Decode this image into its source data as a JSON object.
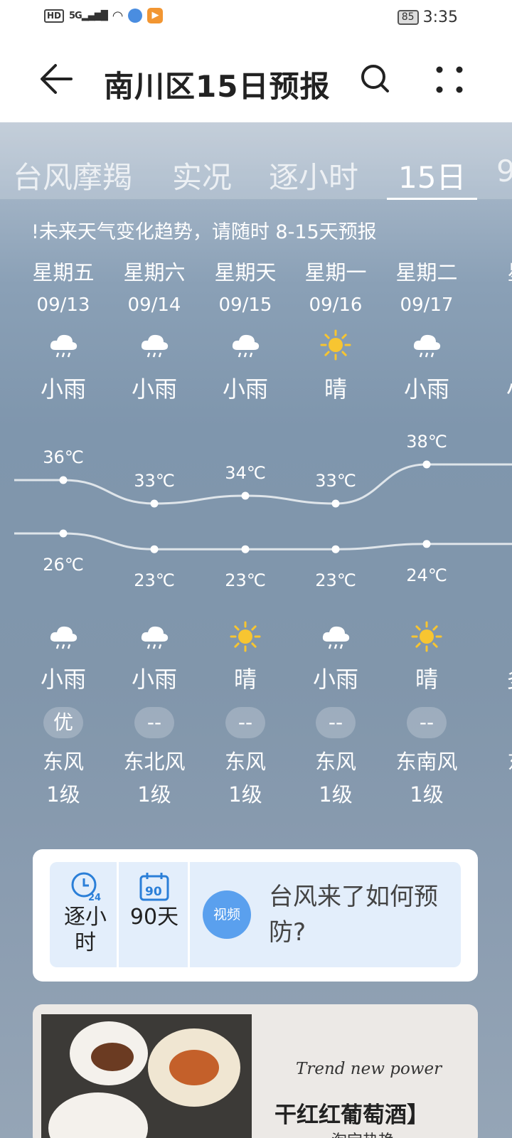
{
  "status": {
    "network": "5G",
    "hd": "HD",
    "battery": "85",
    "time": "3:35"
  },
  "header": {
    "title": "南川区15日预报"
  },
  "tabs": [
    {
      "label": "台风摩羯",
      "active": false
    },
    {
      "label": "实况",
      "active": false
    },
    {
      "label": "逐小时",
      "active": false
    },
    {
      "label": "15日",
      "active": true
    },
    {
      "label": "9",
      "active": false
    }
  ],
  "notice": "!未来天气变化趋势，请随时 8-15天预报",
  "forecast": [
    {
      "day": "星期五",
      "date": "09/13",
      "day_cond": "小雨",
      "day_icon": "cloud-rain-icon",
      "high": "36℃",
      "low": "26℃",
      "high_value": 36,
      "low_value": 26,
      "night_icon": "cloud-rain-icon",
      "night_cond": "小雨",
      "aqi": "优",
      "wind_dir": "东风",
      "wind_level": "1级"
    },
    {
      "day": "星期六",
      "date": "09/14",
      "day_cond": "小雨",
      "day_icon": "cloud-rain-icon",
      "high": "33℃",
      "low": "23℃",
      "high_value": 33,
      "low_value": 23,
      "night_icon": "cloud-rain-icon",
      "night_cond": "小雨",
      "aqi": "--",
      "wind_dir": "东北风",
      "wind_level": "1级"
    },
    {
      "day": "星期天",
      "date": "09/15",
      "day_cond": "小雨",
      "day_icon": "cloud-rain-icon",
      "high": "34℃",
      "low": "23℃",
      "high_value": 34,
      "low_value": 23,
      "night_icon": "sun-icon",
      "night_cond": "晴",
      "aqi": "--",
      "wind_dir": "东风",
      "wind_level": "1级"
    },
    {
      "day": "星期一",
      "date": "09/16",
      "day_cond": "晴",
      "day_icon": "sun-icon",
      "high": "33℃",
      "low": "23℃",
      "high_value": 33,
      "low_value": 23,
      "night_icon": "cloud-rain-icon",
      "night_cond": "小雨",
      "aqi": "--",
      "wind_dir": "东风",
      "wind_level": "1级"
    },
    {
      "day": "星期二",
      "date": "09/17",
      "day_cond": "小雨",
      "day_icon": "cloud-rain-icon",
      "high": "38℃",
      "low": "24℃",
      "high_value": 38,
      "low_value": 24,
      "night_icon": "sun-icon",
      "night_cond": "晴",
      "aqi": "--",
      "wind_dir": "东南风",
      "wind_level": "1级"
    },
    {
      "day": "星",
      "date": "0",
      "day_cond": "小",
      "day_icon": "",
      "high": "3",
      "low": "2",
      "high_value": 38,
      "low_value": 24,
      "night_icon": "",
      "night_cond": "多",
      "aqi": "",
      "wind_dir": "东",
      "wind_level": ""
    }
  ],
  "shortcuts": {
    "hourly": "逐小时",
    "days90": "90天",
    "days90_icon_text": "90",
    "clock_icon_text": "24",
    "video_icon_text": "视频",
    "video_title": "台风来了如何预防?"
  },
  "ad": {
    "tagline": "Trend new power",
    "product": "干红红葡萄酒】",
    "sub": "淘宝热艳"
  }
}
